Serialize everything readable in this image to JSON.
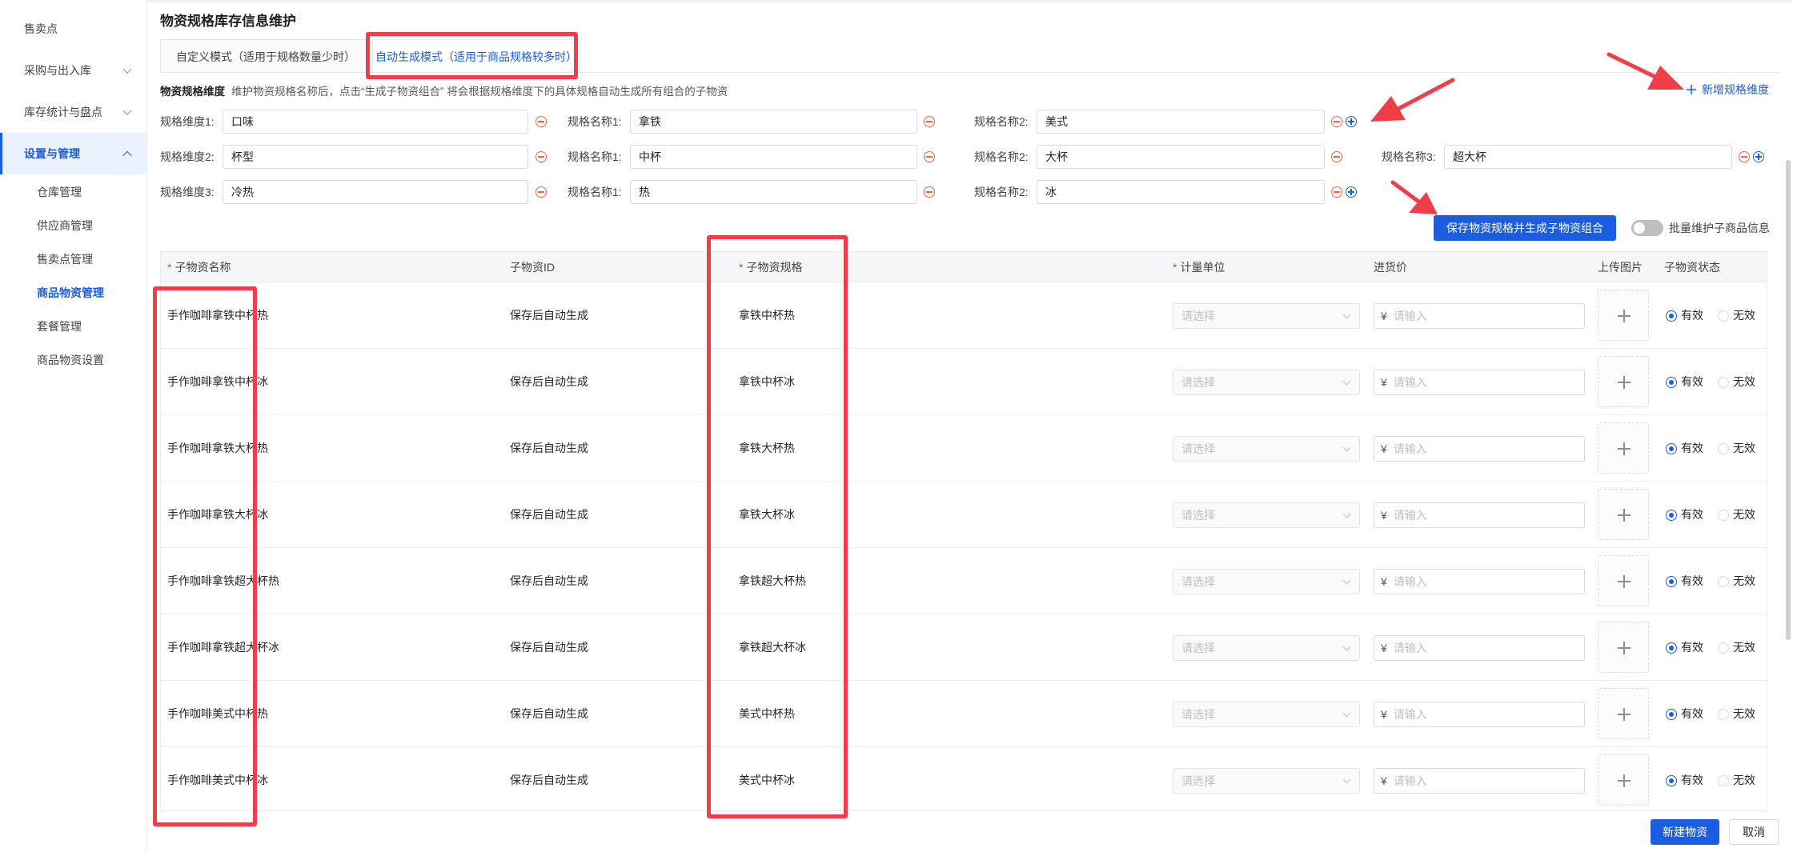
{
  "sidebar": {
    "items": [
      {
        "label": "售卖点"
      },
      {
        "label": "采购与出入库"
      },
      {
        "label": "库存统计与盘点"
      },
      {
        "label": "设置与管理"
      }
    ],
    "sub_items": [
      {
        "label": "仓库管理"
      },
      {
        "label": "供应商管理"
      },
      {
        "label": "售卖点管理"
      },
      {
        "label": "商品物资管理"
      },
      {
        "label": "套餐管理"
      },
      {
        "label": "商品物资设置"
      }
    ]
  },
  "page": {
    "title": "物资规格库存信息维护",
    "tabs": [
      {
        "label": "自定义模式（适用于规格数量少时）"
      },
      {
        "label": "自动生成模式（适用于商品规格较多时）"
      }
    ],
    "desc_title": "物资规格维度",
    "desc_text": "维护物资规格名称后，点击“生成子物资组合” 将会根据规格维度下的具体规格自动生成所有组合的子物资",
    "add_dimension": "新增规格维度"
  },
  "specs": [
    {
      "dim_label": "规格维度1:",
      "dim_value": "口味",
      "names": [
        {
          "label": "规格名称1:",
          "value": "拿铁"
        },
        {
          "label": "规格名称2:",
          "value": "美式"
        }
      ]
    },
    {
      "dim_label": "规格维度2:",
      "dim_value": "杯型",
      "names": [
        {
          "label": "规格名称1:",
          "value": "中杯"
        },
        {
          "label": "规格名称2:",
          "value": "大杯"
        },
        {
          "label": "规格名称3:",
          "value": "超大杯"
        }
      ]
    },
    {
      "dim_label": "规格维度3:",
      "dim_value": "冷热",
      "names": [
        {
          "label": "规格名称1:",
          "value": "热"
        },
        {
          "label": "规格名称2:",
          "value": "冰"
        }
      ]
    }
  ],
  "actions": {
    "save_generate": "保存物资规格并生成子物资组合",
    "batch_label": "批量维护子商品信息",
    "batch_on": false
  },
  "table": {
    "headers": {
      "name": "子物资名称",
      "id": "子物资ID",
      "spec": "子物资规格",
      "unit": "计量单位",
      "price": "进货价",
      "image": "上传图片",
      "status": "子物资状态"
    },
    "required_mark": "*",
    "select_placeholder": "请选择",
    "currency": "¥",
    "price_placeholder": "请输入",
    "status_valid": "有效",
    "status_invalid": "无效",
    "rows": [
      {
        "name": "手作咖啡拿铁中杯热",
        "id": "保存后自动生成",
        "spec": "拿铁中杯热",
        "status": "valid"
      },
      {
        "name": "手作咖啡拿铁中杯冰",
        "id": "保存后自动生成",
        "spec": "拿铁中杯冰",
        "status": "valid"
      },
      {
        "name": "手作咖啡拿铁大杯热",
        "id": "保存后自动生成",
        "spec": "拿铁大杯热",
        "status": "valid"
      },
      {
        "name": "手作咖啡拿铁大杯冰",
        "id": "保存后自动生成",
        "spec": "拿铁大杯冰",
        "status": "valid"
      },
      {
        "name": "手作咖啡拿铁超大杯热",
        "id": "保存后自动生成",
        "spec": "拿铁超大杯热",
        "status": "valid"
      },
      {
        "name": "手作咖啡拿铁超大杯冰",
        "id": "保存后自动生成",
        "spec": "拿铁超大杯冰",
        "status": "valid"
      },
      {
        "name": "手作咖啡美式中杯热",
        "id": "保存后自动生成",
        "spec": "美式中杯热",
        "status": "valid"
      },
      {
        "name": "手作咖啡美式中杯冰",
        "id": "保存后自动生成",
        "spec": "美式中杯冰",
        "status": "valid"
      }
    ]
  },
  "footer": {
    "create": "新建物资",
    "cancel": "取消"
  },
  "colors": {
    "primary": "#1a5de0",
    "annotation_red": "#ef3e48",
    "remove_orange": "#f5623b"
  }
}
